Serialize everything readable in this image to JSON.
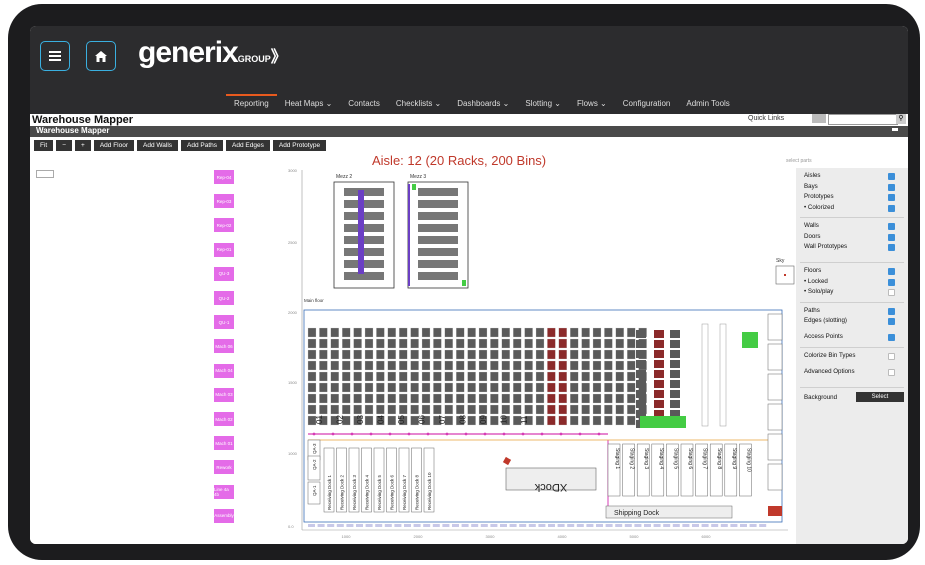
{
  "header": {
    "menu_icon": "hamburger-icon",
    "home_icon": "home-icon",
    "logo_text": "generix",
    "logo_suffix": "GROUP",
    "nav": [
      {
        "label": "Reporting",
        "active": true
      },
      {
        "label": "Heat Maps ⌄",
        "active": false
      },
      {
        "label": "Contacts",
        "active": false
      },
      {
        "label": "Checklists ⌄",
        "active": false
      },
      {
        "label": "Dashboards ⌄",
        "active": false
      },
      {
        "label": "Slotting ⌄",
        "active": false
      },
      {
        "label": "Flows ⌄",
        "active": false
      },
      {
        "label": "Configuration",
        "active": false
      },
      {
        "label": "Admin Tools",
        "active": false
      }
    ]
  },
  "page": {
    "title": "Warehouse Mapper",
    "subtitle": "Warehouse Mapper",
    "quick_links_label": "Quick Links"
  },
  "toolbar": {
    "buttons": [
      "Fit",
      "−",
      "+",
      "Add Floor",
      "Add Walls",
      "Add Paths",
      "Add Edges",
      "Add Prototype"
    ]
  },
  "map": {
    "aisle_title": "Aisle: 12 (20 Racks, 200 Bins)",
    "hint": "select parts",
    "mezz_labels": [
      "Mezz 2",
      "Mezz 3"
    ],
    "sky_label": "Sky",
    "mainfloor_label": "Main floor",
    "xdock_label": "XDock",
    "shipping_label": "Shipping Dock",
    "y_ticks": [
      "3000",
      "2500",
      "2000",
      "1500",
      "1000",
      "0.0"
    ],
    "x_ticks": [
      "1000",
      "2000",
      "3000",
      "4000",
      "5000",
      "6000"
    ],
    "aisle_numbers": [
      "01",
      "02",
      "03",
      "04",
      "05",
      "06",
      "07",
      "08",
      "09",
      "10",
      "11"
    ],
    "receiving_docks": [
      "Receiving Dock 1",
      "Receiving Dock 2",
      "Receiving Dock 3",
      "Receiving Dock 4",
      "Receiving Dock 5",
      "Receiving Dock 6",
      "Receiving Dock 7",
      "Receiving Dock 8",
      "Receiving Dock 10"
    ],
    "staging": [
      "Staging 1",
      "Staging 2",
      "Staging 3",
      "Staging 4",
      "Staging 5",
      "Staging 6",
      "Staging 7",
      "Staging 8",
      "Staging 9",
      "Staging 10"
    ],
    "qa_labels": [
      "QA-3",
      "QA-2",
      "QA-1"
    ],
    "locations": [
      "Rep-04",
      "Rep-03",
      "Rep-02",
      "Rep-01",
      "QU-3",
      "QU-2",
      "QU-1",
      "Mach 06",
      "Mach 04",
      "Mach 03",
      "Mach 02",
      "Mach 01",
      "Rework",
      "Line 4a 4b",
      "Assembly"
    ]
  },
  "options": {
    "groups": [
      [
        {
          "label": "Aisles",
          "checked": true
        },
        {
          "label": "Bays",
          "checked": true
        },
        {
          "label": "Prototypes",
          "checked": true
        },
        {
          "label": "• Colorized",
          "checked": true
        }
      ],
      [
        {
          "label": "Walls",
          "checked": true
        },
        {
          "label": "Doors",
          "checked": true
        },
        {
          "label": "Wall Prototypes",
          "checked": true
        }
      ],
      [
        {
          "label": "Floors",
          "checked": true
        },
        {
          "label": "• Locked",
          "checked": true
        },
        {
          "label": "• Solo/play",
          "checked": false
        }
      ],
      [
        {
          "label": "Paths",
          "checked": true
        },
        {
          "label": "Edges (slotting)",
          "checked": true
        },
        {
          "label": "Access Points",
          "checked": true
        }
      ],
      [
        {
          "label": "Colorize Bin Types",
          "checked": false
        },
        {
          "label": "Advanced Options",
          "checked": false
        }
      ]
    ],
    "background_label": "Background",
    "select_label": "Select"
  },
  "colors": {
    "header": "#2c2c2e",
    "accent": "#3ab0e0",
    "location_pink": "#e46be8",
    "path_pink": "#d63cb5",
    "rack_gray": "#5a5a5a",
    "red": "#c0392b",
    "green": "#44cc44",
    "purple": "#6b3fc4",
    "checkbox_blue": "#3b8fd9"
  }
}
